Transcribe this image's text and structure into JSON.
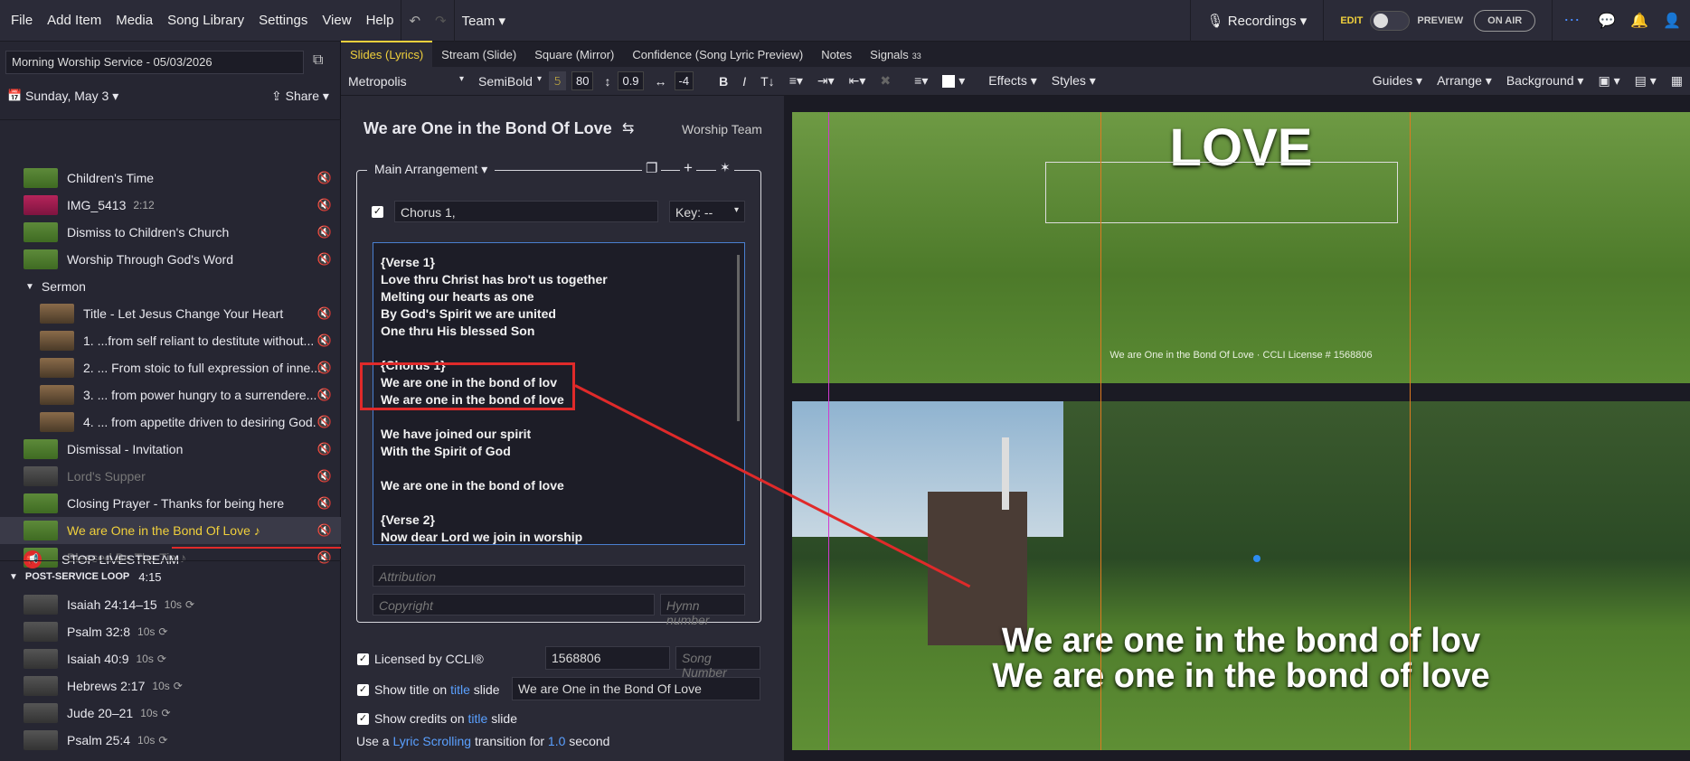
{
  "menu": {
    "file": "File",
    "add_item": "Add Item",
    "media": "Media",
    "song_library": "Song Library",
    "settings": "Settings",
    "view": "View",
    "help": "Help",
    "team": "Team",
    "recordings": "Recordings",
    "edit": "EDIT",
    "preview": "PREVIEW",
    "on_air": "ON AIR"
  },
  "left": {
    "service_title": "Morning Worship Service - 05/03/2026",
    "date": "Sunday, May 3",
    "share": "Share",
    "items": [
      {
        "label": "Children's Time",
        "thumb": "grass"
      },
      {
        "label": "IMG_5413",
        "duration": "2:12",
        "thumb": "rose"
      },
      {
        "label": "Dismiss to Children's Church",
        "thumb": "grass"
      },
      {
        "label": "Worship Through God's Word",
        "thumb": "grass"
      },
      {
        "label": "Sermon",
        "group": true
      },
      {
        "label": "Title - Let Jesus Change Your Heart",
        "thumb": "sepia"
      },
      {
        "label": "1. ...from self reliant to destitute without...",
        "thumb": "sepia"
      },
      {
        "label": "2. ... From stoic to full expression of inne...",
        "thumb": "sepia"
      },
      {
        "label": "3. ... from power hungry to a surrendere...",
        "thumb": "sepia"
      },
      {
        "label": "4. ... from appetite driven to desiring God.",
        "thumb": "sepia"
      },
      {
        "label": "Dismissal - Invitation",
        "thumb": "grass"
      },
      {
        "label": "Lord's Supper",
        "thumb": "grey"
      },
      {
        "label": "Closing Prayer - Thanks for being here",
        "thumb": "grass"
      },
      {
        "label": "We are One in the Bond Of Love ♪",
        "thumb": "grass",
        "selected": true
      },
      {
        "label": "Blessed Be The Tie ♪",
        "thumb": "grass"
      }
    ],
    "stop_livestream": "STOP LIVESTREAM",
    "loop_title": "POST-SERVICE LOOP",
    "loop_duration": "4:15",
    "loop_items": [
      {
        "label": "Isaiah 24:14–15",
        "dur": "10s"
      },
      {
        "label": "Psalm 32:8",
        "dur": "10s"
      },
      {
        "label": "Isaiah 40:9",
        "dur": "10s"
      },
      {
        "label": "Hebrews 2:17",
        "dur": "10s"
      },
      {
        "label": "Jude 20–21",
        "dur": "10s"
      },
      {
        "label": "Psalm 25:4",
        "dur": "10s"
      }
    ]
  },
  "tabs": [
    "Slides (Lyrics)",
    "Stream (Slide)",
    "Square (Mirror)",
    "Confidence (Song Lyric Preview)",
    "Notes",
    "Signals"
  ],
  "signals_count": "33",
  "toolbar": {
    "font": "Metropolis",
    "weight": "SemiBold",
    "size": "80",
    "line": "0.9",
    "spacing": "-4",
    "effects": "Effects",
    "styles": "Styles",
    "guides": "Guides",
    "arrange": "Arrange",
    "background": "Background"
  },
  "editor": {
    "title": "We are One in the Bond Of Love",
    "team": "Worship Team",
    "arrangement": "Main Arrangement",
    "section": "Chorus 1,",
    "key": "Key: --",
    "lyrics": "{Verse 1}\nLove thru Christ has bro't us together\nMelting our hearts as one\nBy God's Spirit we are united\nOne thru His blessed Son\n\n{Chorus 1}\nWe are one in the bond of lov\nWe are one in the bond of love\n\nWe have joined our spirit\nWith the Spirit of God\n\nWe are one in the bond of love\n\n{Verse 2}\nNow dear Lord we join in worship",
    "attribution": "Attribution",
    "copyright": "Copyright",
    "hymn": "Hymn number",
    "licensed": "Licensed by CCLI®",
    "ccli": "1568806",
    "song_number": "Song Number",
    "show_title_a": "Show title on",
    "title_word": "title",
    "show_title_b": "slide",
    "title_value": "We are One in the Bond Of Love",
    "show_credits_a": "Show credits on",
    "show_credits_b": "slide",
    "transition_a": "Use a",
    "transition_link": "Lyric Scrolling",
    "transition_b": "transition for",
    "transition_sec": "1.0",
    "transition_c": "second"
  },
  "slides": {
    "top_title": "LOVE",
    "top_credit": "We are One in the Bond Of Love · CCLI License # 1568806",
    "line1": "We are one in the bond of lov",
    "line2": "We are one in the bond of love"
  }
}
